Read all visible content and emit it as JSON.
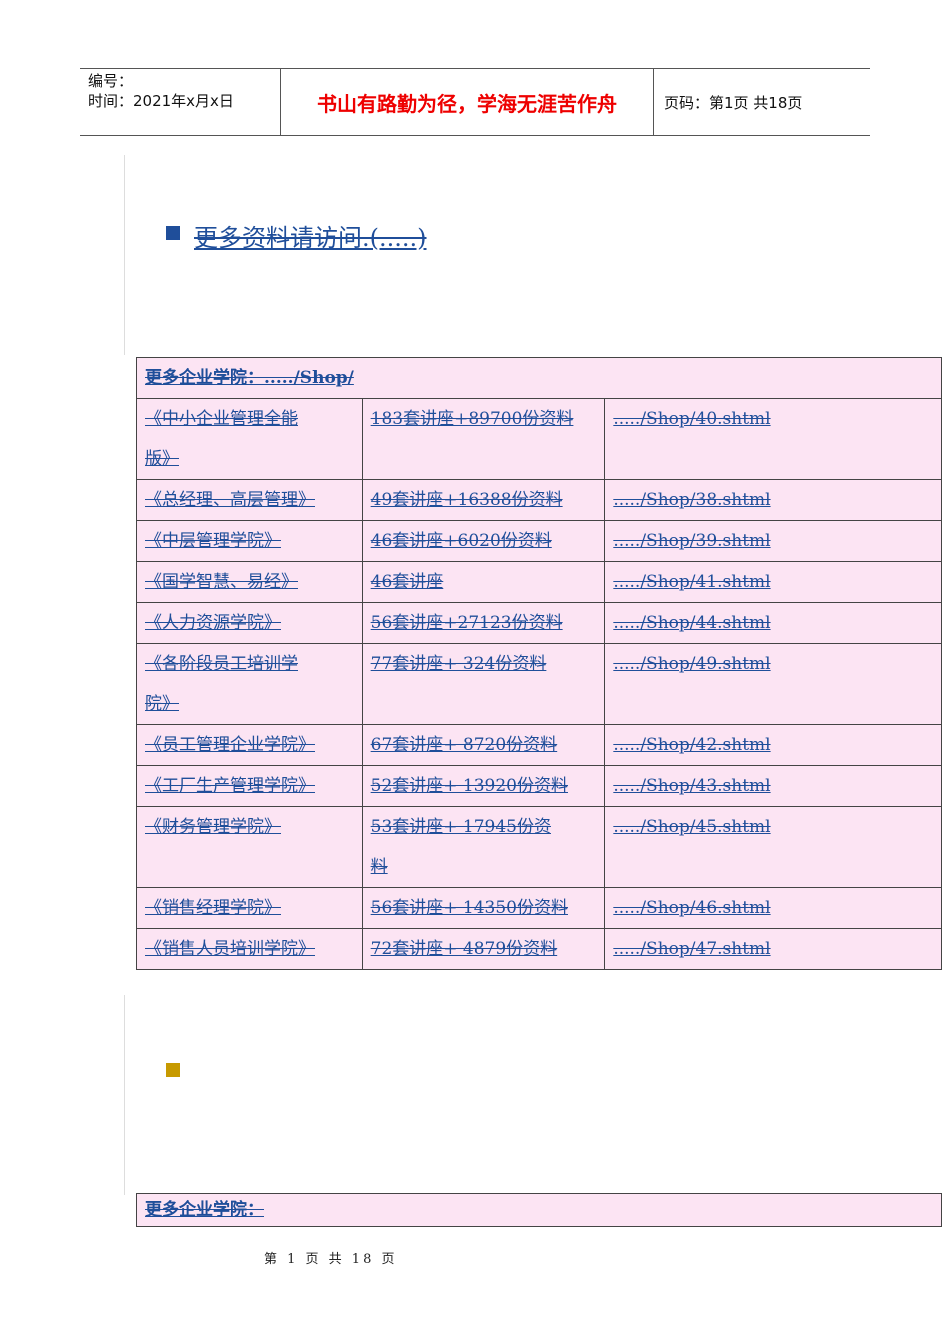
{
  "header": {
    "number_label": "编号：",
    "time_label": "时间：2021年x月x日",
    "motto": "书山有路勤为径，学海无涯苦作舟",
    "page_label": "页码：第1页  共18页"
  },
  "main_link": "更多资料请访问.(.....)",
  "colors": {
    "bullet1": "#1f4e9a",
    "bullet2": "#c79a00",
    "table_bg": "#fce4f3",
    "link": "#1f4e9a",
    "motto": "#e00000"
  },
  "table1": {
    "title": "更多企业学院：...../Shop/",
    "rows": [
      {
        "name": [
          "《中小企业管理全能",
          "版》"
        ],
        "desc": [
          "183套讲座+89700份资料"
        ],
        "url": "...../Shop/40.shtml"
      },
      {
        "name": [
          "《总经理、高层管理》"
        ],
        "desc": [
          "49套讲座+16388份资料"
        ],
        "url": "...../Shop/38.shtml"
      },
      {
        "name": [
          "《中层管理学院》"
        ],
        "desc": [
          "46套讲座+6020份资料 "
        ],
        "url": "...../Shop/39.shtml"
      },
      {
        "name": [
          "《国学智慧、易经》"
        ],
        "desc": [
          "46套讲座"
        ],
        "url": "...../Shop/41.shtml"
      },
      {
        "name": [
          "《人力资源学院》"
        ],
        "desc": [
          "56套讲座+27123份资料"
        ],
        "url": "...../Shop/44.shtml"
      },
      {
        "name": [
          "《各阶段员工培训学",
          "院》"
        ],
        "desc": [
          "77套讲座+ 324份资料"
        ],
        "url": "...../Shop/49.shtml"
      },
      {
        "name": [
          "《员工管理企业学院》"
        ],
        "desc": [
          "67套讲座+ 8720份资料"
        ],
        "url": "...../Shop/42.shtml"
      },
      {
        "name": [
          "《工厂生产管理学院》"
        ],
        "desc": [
          "52套讲座+ 13920份资料"
        ],
        "url": "...../Shop/43.shtml"
      },
      {
        "name": [
          "《财务管理学院》"
        ],
        "desc": [
          "53套讲座+ 17945份资",
          "料 "
        ],
        "url": "...../Shop/45.shtml"
      },
      {
        "name": [
          "《销售经理学院》"
        ],
        "desc": [
          "56套讲座+ 14350份资料"
        ],
        "url": "...../Shop/46.shtml"
      },
      {
        "name": [
          "《销售人员培训学院》"
        ],
        "desc": [
          "72套讲座+ 4879份资料"
        ],
        "url": "...../Shop/47.shtml"
      }
    ]
  },
  "table2": {
    "title": "更多企业学院： "
  },
  "footer": {
    "text": "第 1 页 共 18 页"
  }
}
